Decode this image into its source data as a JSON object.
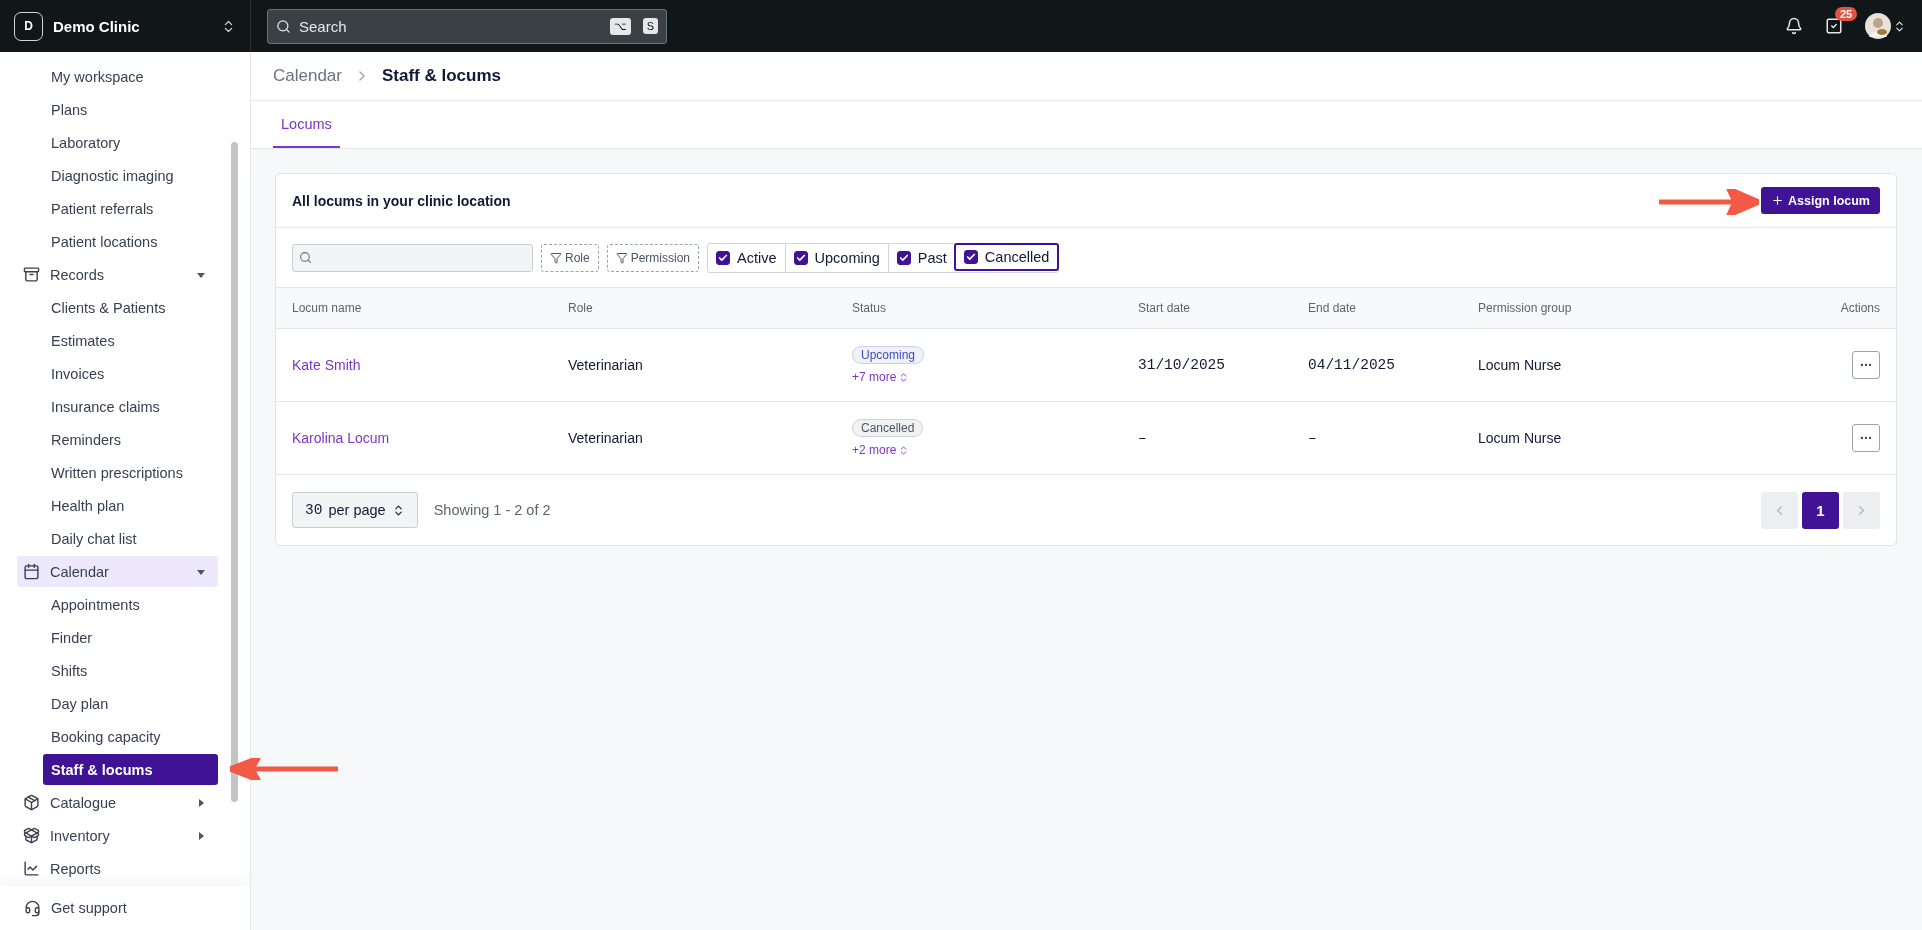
{
  "topbar": {
    "clinic": {
      "initial": "D",
      "name": "Demo Clinic"
    },
    "search": {
      "placeholder": "Search",
      "shortcut": [
        "⌥",
        "S"
      ]
    },
    "tasks_badge": "25"
  },
  "sidebar": {
    "items": [
      {
        "kind": "link",
        "label": "My workspace",
        "selected": false
      },
      {
        "kind": "link",
        "label": "Plans",
        "selected": false
      },
      {
        "kind": "link",
        "label": "Laboratory",
        "selected": false
      },
      {
        "kind": "link",
        "label": "Diagnostic imaging",
        "selected": false
      },
      {
        "kind": "link",
        "label": "Patient referrals",
        "selected": false
      },
      {
        "kind": "link",
        "label": "Patient locations",
        "selected": false
      },
      {
        "kind": "group",
        "label": "Records",
        "selected": false,
        "expanded": true
      },
      {
        "kind": "link",
        "label": "Clients & Patients",
        "selected": false
      },
      {
        "kind": "link",
        "label": "Estimates",
        "selected": false
      },
      {
        "kind": "link",
        "label": "Invoices",
        "selected": false
      },
      {
        "kind": "link",
        "label": "Insurance claims",
        "selected": false
      },
      {
        "kind": "link",
        "label": "Reminders",
        "selected": false
      },
      {
        "kind": "link",
        "label": "Written prescriptions",
        "selected": false
      },
      {
        "kind": "link",
        "label": "Health plan",
        "selected": false
      },
      {
        "kind": "link",
        "label": "Daily chat list",
        "selected": false
      },
      {
        "kind": "group",
        "label": "Calendar",
        "selected": true,
        "expanded": true
      },
      {
        "kind": "link",
        "label": "Appointments",
        "selected": false
      },
      {
        "kind": "link",
        "label": "Finder",
        "selected": false
      },
      {
        "kind": "link",
        "label": "Shifts",
        "selected": false
      },
      {
        "kind": "link",
        "label": "Day plan",
        "selected": false
      },
      {
        "kind": "link",
        "label": "Booking capacity",
        "selected": false
      },
      {
        "kind": "link",
        "label": "Staff & locums",
        "selected": true
      },
      {
        "kind": "group",
        "label": "Catalogue",
        "selected": false,
        "expanded": false
      },
      {
        "kind": "group",
        "label": "Inventory",
        "selected": false,
        "expanded": false
      },
      {
        "kind": "group",
        "label": "Reports",
        "selected": false
      }
    ],
    "footer": "Get support"
  },
  "breadcrumb": [
    "Calendar",
    "Staff & locums"
  ],
  "tabs": [
    {
      "label": "Locums",
      "selected": true
    }
  ],
  "card": {
    "title": "All locums in your clinic location",
    "action": "Assign locum",
    "filters": {
      "buttons": [
        "Role",
        "Permission"
      ],
      "statuses": [
        {
          "label": "Active",
          "checked": true,
          "focused": false
        },
        {
          "label": "Upcoming",
          "checked": true,
          "focused": false
        },
        {
          "label": "Past",
          "checked": true,
          "focused": false
        },
        {
          "label": "Cancelled",
          "checked": true,
          "focused": true
        }
      ]
    },
    "table": {
      "columns": [
        "Locum name",
        "Role",
        "Status",
        "Start date",
        "End date",
        "Permission group",
        "Actions"
      ],
      "rows": [
        {
          "name": "Kate Smith",
          "role": "Veterinarian",
          "status": {
            "label": "Upcoming",
            "color": "#3d4db7"
          },
          "more": "+7 more",
          "start": "31/10/2025",
          "end": "04/11/2025",
          "permission": "Locum Nurse"
        },
        {
          "name": "Karolina Locum",
          "role": "Veterinarian",
          "status": {
            "label": "Cancelled",
            "color": "#4b5563"
          },
          "more": "+2 more",
          "start": "–",
          "end": "–",
          "permission": "Locum Nurse"
        }
      ]
    },
    "pagination": {
      "per_page": "30",
      "per_page_label": "per page",
      "summary": "Showing 1 - 2 of 2",
      "prev_disabled": true,
      "next_disabled": true,
      "pages": [
        {
          "label": "1",
          "selected": true
        }
      ]
    }
  }
}
